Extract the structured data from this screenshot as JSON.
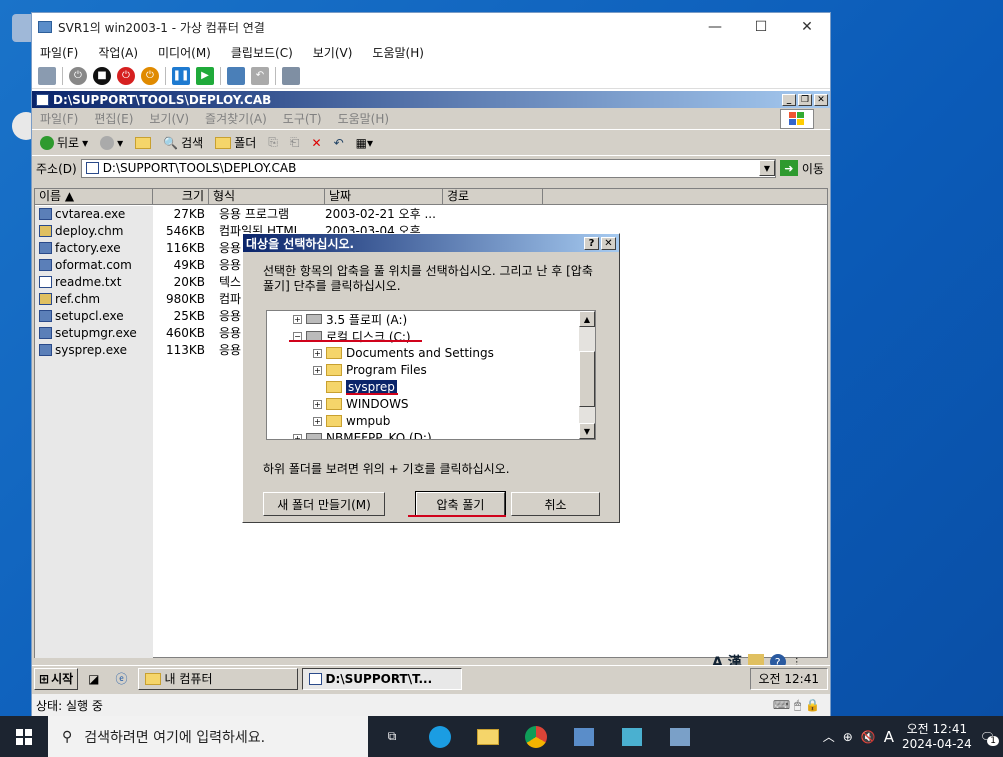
{
  "host": {
    "title": "SVR1의 win2003-1 - 가상 컴퓨터 연결",
    "menu": [
      "파일(F)",
      "작업(A)",
      "미디어(M)",
      "클립보드(C)",
      "보기(V)",
      "도움말(H)"
    ],
    "status": "상태: 실행 중"
  },
  "explorer": {
    "title": "D:\\SUPPORT\\TOOLS\\DEPLOY.CAB",
    "menu": [
      "파일(F)",
      "편집(E)",
      "보기(V)",
      "즐겨찾기(A)",
      "도구(T)",
      "도움말(H)"
    ],
    "toolbar": {
      "back": "뒤로",
      "search": "검색",
      "folders": "폴더"
    },
    "address_label": "주소(D)",
    "address_value": "D:\\SUPPORT\\TOOLS\\DEPLOY.CAB",
    "go_label": "이동",
    "columns": [
      "이름",
      "크기",
      "형식",
      "날짜",
      "경로"
    ],
    "files": [
      {
        "name": "cvtarea.exe",
        "size": "27KB",
        "type": "응용 프로그램",
        "date": "2003-02-21 오후 ..."
      },
      {
        "name": "deploy.chm",
        "size": "546KB",
        "type": "컴파일된 HTML ...",
        "date": "2003-03-04 오후 ..."
      },
      {
        "name": "factory.exe",
        "size": "116KB",
        "type": "응용",
        "date": ""
      },
      {
        "name": "oformat.com",
        "size": "49KB",
        "type": "응용",
        "date": ""
      },
      {
        "name": "readme.txt",
        "size": "20KB",
        "type": "텍스",
        "date": ""
      },
      {
        "name": "ref.chm",
        "size": "980KB",
        "type": "컴파",
        "date": ""
      },
      {
        "name": "setupcl.exe",
        "size": "25KB",
        "type": "응용",
        "date": ""
      },
      {
        "name": "setupmgr.exe",
        "size": "460KB",
        "type": "응용",
        "date": ""
      },
      {
        "name": "sysprep.exe",
        "size": "113KB",
        "type": "응용",
        "date": ""
      }
    ]
  },
  "dialog": {
    "title": "대상을 선택하십시오.",
    "message": "선택한 항목의 압축을 풀 위치를 선택하십시오. 그리고 난 후 [압축 풀기] 단추를 클릭하십시오.",
    "tree": [
      "3.5 플로피 (A:)",
      "로컬 디스크 (C:)",
      "Documents and Settings",
      "Program Files",
      "sysprep",
      "WINDOWS",
      "wmpub",
      "NBMEFPP_KO (D:)"
    ],
    "hint": "하위 폴더를 보려면 위의 + 기호를 클릭하십시오.",
    "new_folder": "새 폴더 만들기(M)",
    "extract": "압축 풀기",
    "cancel": "취소"
  },
  "guest_taskbar": {
    "start": "시작",
    "items": [
      "내 컴퓨터",
      "D:\\SUPPORT\\T..."
    ],
    "clock": "오전 12:41"
  },
  "win10": {
    "search_placeholder": "검색하려면 여기에 입력하세요.",
    "time": "오전 12:41",
    "date": "2024-04-24",
    "ime": "A",
    "notification_count": "1"
  },
  "ime_bar": {
    "mode": "A 漢"
  },
  "colors": {
    "annotation": "#d0021b",
    "title_grad_start": "#0a246a",
    "desktop": "#0b5bb8"
  }
}
